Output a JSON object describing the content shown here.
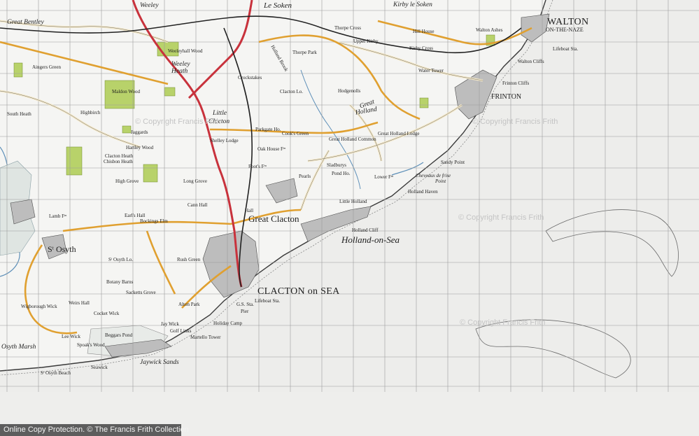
{
  "labels": {
    "walton": "WALTON",
    "on_the_naze": "ON-THE-NAZE",
    "frinton": "FRINTON",
    "clacton": "CLACTON on SEA",
    "great_clacton": "Great Clacton",
    "holland_on_sea": "Holland-on-Sea",
    "little_clacton_1": "Little",
    "little_clacton_2": "Clacton",
    "great_holland_1": "Great",
    "great_holland_2": "Holland",
    "stosyth": "Sᵗ Osyth",
    "jaywick_sands": "Jaywick Sands",
    "weeley": "Weeley",
    "weeley_heath_1": "Weeley",
    "weeley_heath_2": "Heath",
    "le_soken": "Le Soken",
    "kirby_le_soken": "Kirby le Soken",
    "great_bentley": "Great Bentley",
    "sandy_point": "Sandy Point",
    "holland_haven": "Holland Haven",
    "holland_cliff": "Holland Cliff",
    "cheveaux": "Cheveaux de frise",
    "cheveaux_2": "Point",
    "walton_cliffs": "Walton Cliffs",
    "frinton_cliffs": "Frinton Cliffs",
    "lifeboat_sta": "Lifeboat Sta.",
    "lifeboat_sta_2": "Lifeboat Sta.",
    "osyth_marsh": "Osyth Marsh",
    "st_osyth_beach": "Sᵗ Osyth Beach",
    "holiday_camp": "Holiday Camp",
    "martello_tower": "Martello Tower",
    "golf_links": "Golf Links",
    "jaywick": "Jay Wick",
    "little_holland": "Little Holland",
    "bockings_elm": "Bockings Elm",
    "rush_green": "Rush Green",
    "clacton_heath": "Clacton Heath",
    "pearls": "Pearls",
    "slade": "Sladburys",
    "cooks_green": "Cook's Green",
    "great_holland_common": "Great Holland Common",
    "hodgenolls": "Hodgenolls",
    "upper_kirby": "Upper Kirby",
    "kirby_cross": "Kirby Cross",
    "thorpe_cross": "Thorpe Cross",
    "thorpe_park": "Thorpe Park",
    "holland_brook": "Holland Brook",
    "cann_hall": "Cann Hall",
    "shelley_lodge": "Shelley Lodge",
    "oak_house": "Oak House Fᵐ",
    "maldon_wood": "Maldon Wood",
    "aingers_green": "Aingers Green",
    "south_heath": "South Heath",
    "highbirch": "Highbirch",
    "botany_barns": "Botany Barns",
    "weeley_wood": "Weeleyhall Wood",
    "water_tower": "Water Tower",
    "hill_house": "Hill House",
    "walton_ashes": "Walton Ashes",
    "great_holland_lodge": "Great Holland Lodge",
    "lower_farm": "Lower Fᵐ",
    "jaggards": "Jaggards",
    "seawick": "Seawick",
    "lee_wick": "Lee Wick",
    "st_osyth_lo": "Sᵗ Osyth Lo.",
    "ghs": "G.S. Sta.",
    "pier": "Pier",
    "alton_park": "Alton Park",
    "sacketts_grove": "Sacketts Grove",
    "earls_hall": "Earl's Hall",
    "lamb_farm": "Lamb Fᵐ",
    "hartley_wood": "Hartley Wood",
    "crockstakes": "Crockstakes",
    "parkgate": "Parkgate Ho.",
    "clactonbrook": "Clacton Lo.",
    "high_grove": "High Grove",
    "long_grove": "Long Grove",
    "foots": "Foot's Fᵐ",
    "pond_ho": "Pond Ho.",
    "hall": "Hall",
    "chisbon": "Chisbon Heath",
    "beggars": "Beggars Pond",
    "spoak": "Spoak's Wood",
    "wigboro": "Wigborough Wick",
    "cocket": "Cocket Wick",
    "weirs": "Weirs Hall"
  },
  "watermarks": [
    "© Copyright Francis Frith",
    "© Copyright Francis Frith",
    "© Copyright Francis Frith",
    "© Copyright Francis Frith"
  ],
  "footer": "Online Copy Protection. © The Francis Frith Collection"
}
